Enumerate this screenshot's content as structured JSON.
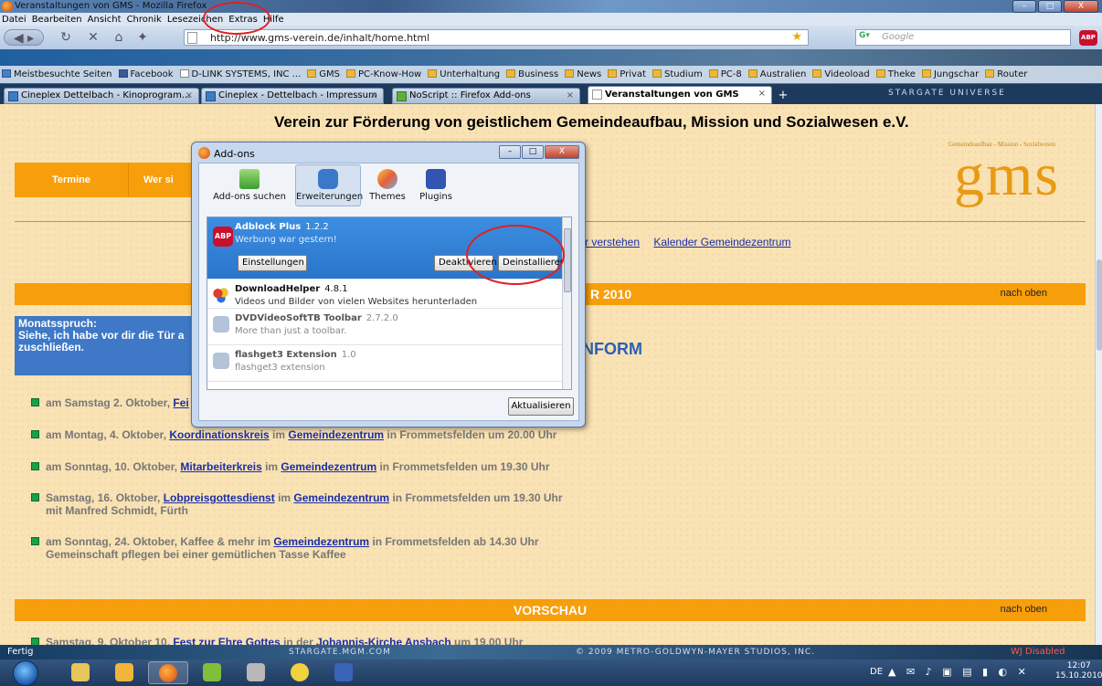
{
  "window": {
    "title": "Veranstaltungen von GMS - Mozilla Firefox",
    "buttons": [
      "–",
      "□",
      "X"
    ]
  },
  "menu": [
    "Datei",
    "Bearbeiten",
    "Ansicht",
    "Chronik",
    "Lesezeichen",
    "Extras",
    "Hilfe"
  ],
  "navbar": {
    "url": "http://www.gms-verein.de/inhalt/home.html",
    "search_placeholder": "Google",
    "abp_label": "ABP"
  },
  "bookmarks": [
    {
      "label": "Meistbesuchte Seiten",
      "icon": "ms"
    },
    {
      "label": "Facebook",
      "icon": "fb"
    },
    {
      "label": "D-LINK SYSTEMS, INC ...",
      "icon": "doc"
    },
    {
      "label": "GMS",
      "icon": "folder"
    },
    {
      "label": "PC-Know-How",
      "icon": "folder"
    },
    {
      "label": "Unterhaltung",
      "icon": "folder"
    },
    {
      "label": "Business",
      "icon": "folder"
    },
    {
      "label": "News",
      "icon": "folder"
    },
    {
      "label": "Privat",
      "icon": "folder"
    },
    {
      "label": "Studium",
      "icon": "folder"
    },
    {
      "label": "PC-8",
      "icon": "folder"
    },
    {
      "label": "Australien",
      "icon": "folder"
    },
    {
      "label": "Videoload",
      "icon": "folder"
    },
    {
      "label": "Theke",
      "icon": "folder"
    },
    {
      "label": "Jungschar",
      "icon": "folder"
    },
    {
      "label": "Router",
      "icon": "folder"
    }
  ],
  "tabs": [
    {
      "label": "Cineplex Dettelbach - Kinoprogram..."
    },
    {
      "label": "Cineplex - Dettelbach - Impressum"
    },
    {
      "label": "NoScript :: Firefox Add-ons"
    },
    {
      "label": "Veranstaltungen von GMS",
      "active": true
    }
  ],
  "theme_logo": "STARGATE UNIVERSE",
  "page": {
    "headline": "Verein zur Förderung von geistlichem Gemeindeaufbau, Mission und Sozialwesen e.V.",
    "logo_tagline": "Gemeindeaufbau - Mission - Sozialwesen",
    "logo_text": "gms",
    "nav": [
      "Termine",
      "Wer si"
    ],
    "links": [
      "r verstehen",
      "Kalender Gemeindezentrum"
    ],
    "bar1_title": "R 2010",
    "nach_oben": "nach oben",
    "monatsspruch": "Monatsspruch:\nSiehe, ich habe vor dir die Tür a\nzuschließen.",
    "inform": "NFORM",
    "events": [
      {
        "pre": "am Samstag 2. Oktober, ",
        "link": "Fei",
        "post": ""
      },
      {
        "pre": "am Montag, 4. Oktober, ",
        "link": "Koordinationskreis",
        "mid": " im ",
        "link2": "Gemeindezentrum",
        "post": " in Frommetsfelden um 20.00 Uhr"
      },
      {
        "pre": "am Sonntag, 10. Oktober, ",
        "link": "Mitarbeiterkreis",
        "mid": " im ",
        "link2": "Gemeindezentrum",
        "post": " in Frommetsfelden um 19.30 Uhr"
      },
      {
        "pre": "Samstag, 16. Oktober,  ",
        "link": "Lobpreisgottesdienst",
        "mid": " im ",
        "link2": "Gemeindezentrum",
        "post": " in Frommetsfelden um 19.30 Uhr",
        "sub": "mit Manfred Schmidt, Fürth"
      },
      {
        "pre": "am Sonntag, 24. Oktober, Kaffee & mehr im ",
        "link": "Gemeindezentrum",
        "post": " in Frommetsfelden ab 14.30 Uhr",
        "sub": "Gemeinschaft pflegen bei einer gemütlichen Tasse Kaffee"
      },
      {
        "pre": "Samstag, 9. Oktober 10, ",
        "link": "Fest zur Ehre Gottes",
        "mid": " in der ",
        "link2": "Johannis-Kirche Ansbach",
        "post": " um 19.00 Uhr"
      }
    ],
    "vorschau": "VORSCHAU"
  },
  "addons": {
    "title": "Add-ons",
    "categories": [
      "Add-ons suchen",
      "Erweiterungen",
      "Themes",
      "Plugins"
    ],
    "items": [
      {
        "name": "Adblock Plus",
        "version": "1.2.2",
        "desc": "Werbung war gestern!",
        "icon": "abp-icon",
        "selected": true
      },
      {
        "name": "DownloadHelper",
        "version": "4.8.1",
        "desc": "Videos und Bilder von vielen Websites herunterladen",
        "icon": "downloadhelper-icon"
      },
      {
        "name": "DVDVideoSoftTB Toolbar",
        "version": "2.7.2.0",
        "desc": "More than just a toolbar.",
        "icon": "puzzle-icon",
        "disabled": true
      },
      {
        "name": "flashget3 Extension",
        "version": "1.0",
        "desc": "flashget3 extension",
        "icon": "puzzle-icon",
        "disabled": true
      }
    ],
    "btn_settings": "Einstellungen",
    "btn_deactivate": "Deaktivieren",
    "btn_uninstall": "Deinstallieren",
    "btn_update": "Aktualisieren"
  },
  "status": {
    "text": "Fertig",
    "credit1": "STARGATE.MGM.COM",
    "credit2": "© 2009 METRO-GOLDWYN-MAYER STUDIOS, INC.",
    "wj": "WJ Disabled"
  },
  "taskbar": {
    "lang": "DE",
    "time": "12:07",
    "date": "15.10.2010"
  },
  "colors": {
    "page_bg": "#f9e2b4",
    "orange": "#f79e0b",
    "link": "#1a2fa8",
    "monat_bg": "#3e78c6",
    "annotation": "#e02020"
  }
}
